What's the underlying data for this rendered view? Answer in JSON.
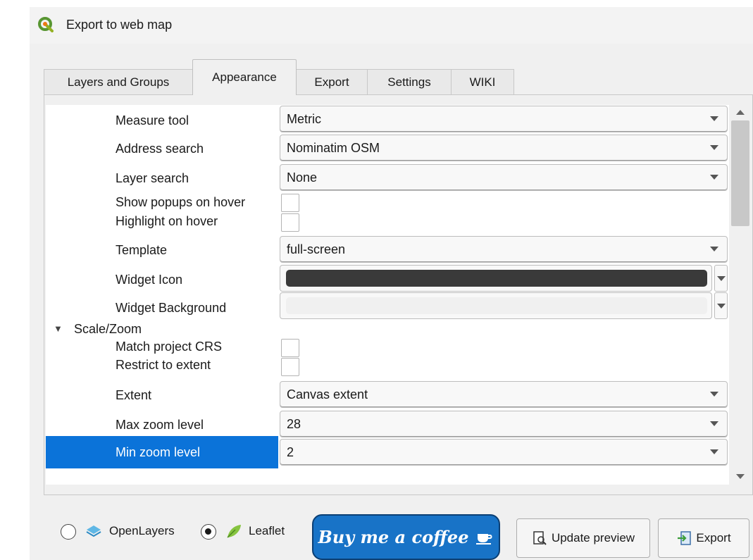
{
  "window": {
    "title": "Export to web map",
    "app_icon": "qgis-logo-icon"
  },
  "tabs": [
    {
      "label": "Layers and Groups"
    },
    {
      "label": "Appearance",
      "active": true
    },
    {
      "label": "Export"
    },
    {
      "label": "Settings"
    },
    {
      "label": "WIKI"
    }
  ],
  "appearance": {
    "measure_tool": {
      "label": "Measure tool",
      "value": "Metric"
    },
    "address_search": {
      "label": "Address search",
      "value": "Nominatim OSM"
    },
    "layer_search": {
      "label": "Layer search",
      "value": "None"
    },
    "show_popups_on_hover": {
      "label": "Show popups on hover",
      "checked": false
    },
    "highlight_on_hover": {
      "label": "Highlight on hover",
      "checked": false
    },
    "template": {
      "label": "Template",
      "value": "full-screen"
    },
    "widget_icon": {
      "label": "Widget Icon",
      "color": "#3a3a3a"
    },
    "widget_background": {
      "label": "Widget Background",
      "color": "#f0f0f0"
    }
  },
  "scale_zoom": {
    "group_label": "Scale/Zoom",
    "expanded": true,
    "match_project_crs": {
      "label": "Match project CRS",
      "checked": false
    },
    "restrict_to_extent": {
      "label": "Restrict to extent",
      "checked": false
    },
    "extent": {
      "label": "Extent",
      "value": "Canvas extent"
    },
    "max_zoom": {
      "label": "Max zoom level",
      "value": "28"
    },
    "min_zoom": {
      "label": "Min zoom level",
      "value": "2",
      "selected": true
    }
  },
  "footer": {
    "openlayers": {
      "label": "OpenLayers",
      "selected": false,
      "icon": "openlayers-icon"
    },
    "leaflet": {
      "label": "Leaflet",
      "selected": true,
      "icon": "leaflet-icon"
    },
    "coffee_label": "Buy me a coffee",
    "update_preview_label": "Update preview",
    "export_label": "Export"
  },
  "colors": {
    "selection": "#0b73d9",
    "coffee_button": "#1873c7"
  }
}
